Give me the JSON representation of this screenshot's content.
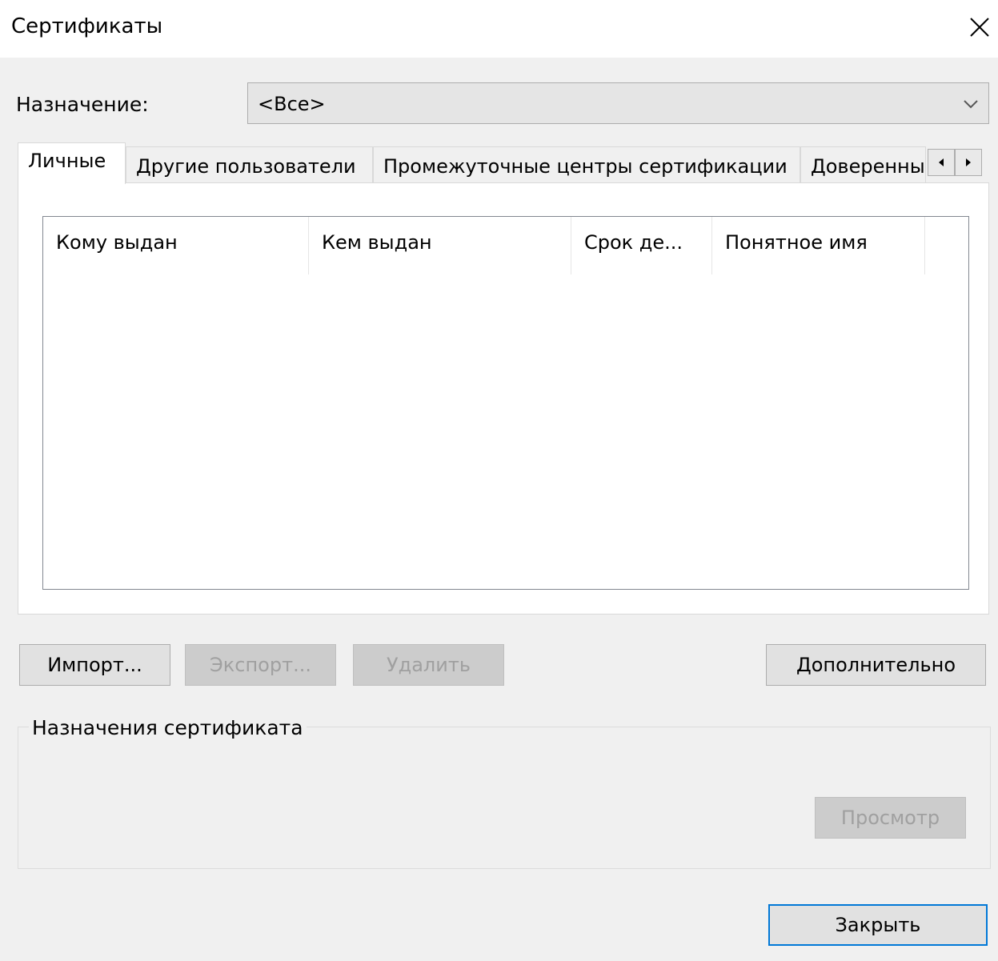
{
  "window": {
    "title": "Сертификаты",
    "close_icon": "close-icon"
  },
  "purpose": {
    "label": "Назначение:",
    "selected": "<Все>",
    "arrow_icon": "chevron-down-icon"
  },
  "tabs": [
    {
      "label": "Личные",
      "active": true
    },
    {
      "label": "Другие пользователи",
      "active": false
    },
    {
      "label": "Промежуточные центры сертификации",
      "active": false
    },
    {
      "label": "Доверенны",
      "active": false
    }
  ],
  "tab_scroll": {
    "left_icon": "arrow-left-icon",
    "right_icon": "arrow-right-icon"
  },
  "list": {
    "columns": [
      "Кому выдан",
      "Кем выдан",
      "Срок де...",
      "Понятное имя"
    ],
    "rows": []
  },
  "buttons": {
    "import": "Импорт...",
    "export": "Экспорт...",
    "delete": "Удалить",
    "advanced": "Дополнительно",
    "view": "Просмотр",
    "close": "Закрыть"
  },
  "cert_purposes": {
    "label": "Назначения сертификата"
  },
  "colors": {
    "dialog_bg": "#f0f0f0",
    "titlebar_bg": "#ffffff",
    "default_button_border": "#0078d7",
    "disabled_text": "#a0a0a0"
  }
}
